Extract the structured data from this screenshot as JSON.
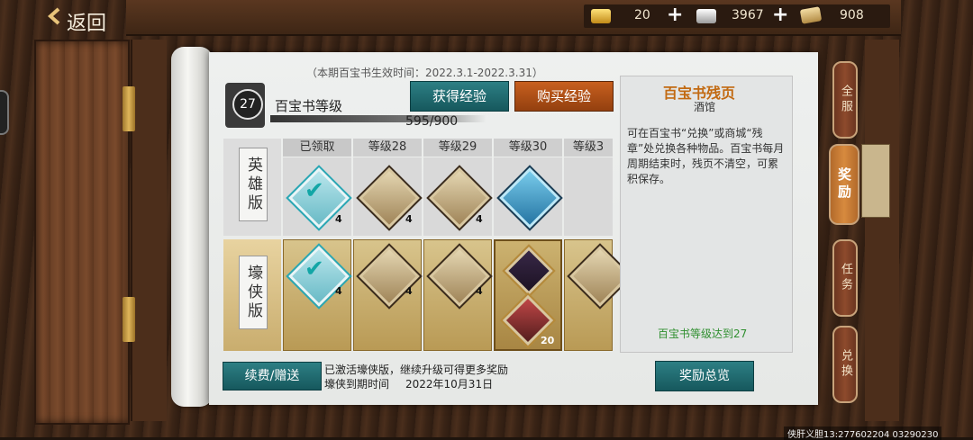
{
  "header": {
    "back_label": "返回",
    "resources": [
      {
        "icon": "gold-ingot-icon",
        "value": "20"
      },
      {
        "icon": "silver-ingot-icon",
        "value": "3967"
      },
      {
        "icon": "scroll-ticket-icon",
        "value": "908"
      }
    ]
  },
  "book": {
    "period": "（本期百宝书生效时间：2022.3.1-2022.3.31）",
    "level": "27",
    "level_title": "百宝书等级",
    "exp_text": "595/900",
    "exp_progress": 0.661,
    "get_exp_label": "获得经验",
    "buy_exp_label": "购买经验"
  },
  "grid": {
    "rows": [
      {
        "label": "英雄版"
      },
      {
        "label": "壕侠版"
      }
    ],
    "columns": [
      {
        "header": "已领取",
        "hero": {
          "item": "reward-chest-icon",
          "qty": "4",
          "claimed": true
        },
        "vip": {
          "item": "reward-chest-icon",
          "qty": "4",
          "claimed": true
        }
      },
      {
        "header": "等级28",
        "hero": {
          "item": "reward-chest-icon",
          "qty": "4",
          "claimed": false
        },
        "vip": {
          "item": "reward-chest-icon",
          "qty": "4",
          "claimed": false
        }
      },
      {
        "header": "等级29",
        "hero": {
          "item": "reward-chest-icon",
          "qty": "4",
          "claimed": false
        },
        "vip": {
          "item": "reward-chest-icon",
          "qty": "4",
          "claimed": false
        }
      },
      {
        "header": "等级30",
        "hero": {
          "item": "blue-cube-icon",
          "qty": "",
          "claimed": false
        },
        "vip": {
          "item": "teapot-icon",
          "qty": "20",
          "claimed": false
        }
      },
      {
        "header": "等级3",
        "hero": {
          "item": "",
          "qty": "",
          "claimed": false
        },
        "vip": {
          "item": "reward-chest-icon",
          "qty": "",
          "claimed": false
        }
      }
    ]
  },
  "info": {
    "title": "百宝书残页",
    "subtitle": "酒馆",
    "description": "可在百宝书“兑换”或商城“残章”处兑换各种物品。百宝书每月周期结束时，残页不清空，可累积保存。",
    "requirement": "百宝书等级达到27"
  },
  "footer": {
    "renew_label": "续费/赠送",
    "activated_text": "已激活壕侠版，继续升级可得更多奖励",
    "expire_label": "壕侠到期时间",
    "expire_date": "2022年10月31日",
    "overview_label": "奖励总览"
  },
  "side_tabs": [
    {
      "label": "全服",
      "active": false
    },
    {
      "label": "奖励",
      "active": true
    },
    {
      "label": "任务",
      "active": false
    },
    {
      "label": "兑换",
      "active": false
    }
  ],
  "watermark": "侠肝义胆13:277602204 03290230",
  "colors": {
    "teal_button": "#16585d",
    "orange_button": "#93400f",
    "info_title": "#c26a12",
    "requirement": "#2f8f2f"
  }
}
